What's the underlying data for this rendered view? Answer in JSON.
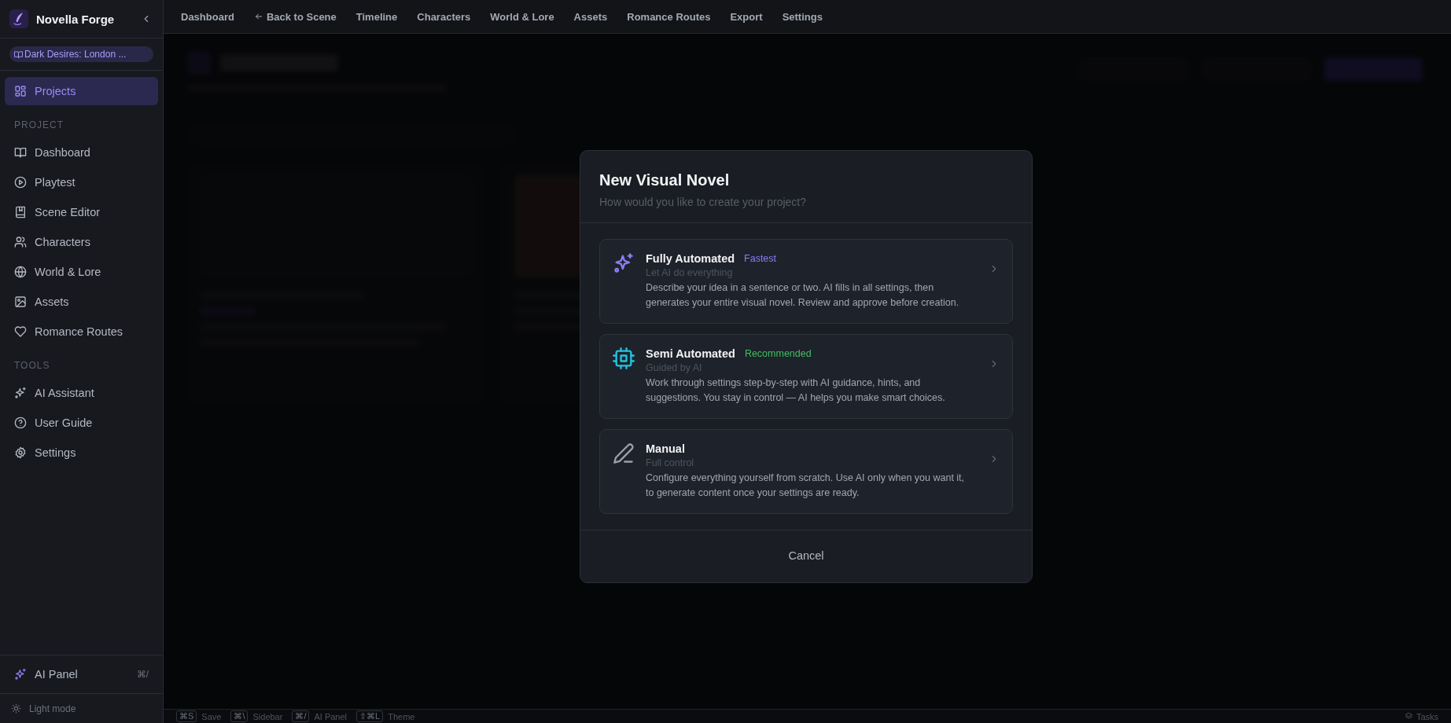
{
  "sidebar": {
    "app_name": "Novella Forge",
    "project_chip": "Dark Desires: London ...",
    "top_items": [
      {
        "label": "Projects",
        "kind": "grid",
        "selected": true
      }
    ],
    "sections": [
      {
        "heading": "PROJECT",
        "items": [
          {
            "label": "Dashboard",
            "kind": "book",
            "selected": false
          },
          {
            "label": "Playtest",
            "kind": "play",
            "selected": false
          },
          {
            "label": "Scene Editor",
            "kind": "bookmark",
            "selected": false
          },
          {
            "label": "Characters",
            "kind": "users",
            "selected": false
          },
          {
            "label": "World & Lore",
            "kind": "globe",
            "selected": false
          },
          {
            "label": "Assets",
            "kind": "image",
            "selected": false
          },
          {
            "label": "Romance Routes",
            "kind": "heart",
            "selected": false
          }
        ]
      },
      {
        "heading": "TOOLS",
        "items": [
          {
            "label": "AI Assistant",
            "kind": "sparkles",
            "selected": false
          },
          {
            "label": "User Guide",
            "kind": "help",
            "selected": false
          },
          {
            "label": "Settings",
            "kind": "gear",
            "selected": false
          }
        ]
      }
    ],
    "ai_panel": {
      "label": "AI Panel",
      "shortcut": "⌘/"
    },
    "theme_toggle": "Light mode"
  },
  "top_nav": [
    {
      "label": "Dashboard",
      "kind": "link"
    },
    {
      "label": "Back to Scene",
      "kind": "back"
    },
    {
      "label": "Timeline",
      "kind": "link"
    },
    {
      "label": "Characters",
      "kind": "link"
    },
    {
      "label": "World & Lore",
      "kind": "link"
    },
    {
      "label": "Assets",
      "kind": "link"
    },
    {
      "label": "Romance Routes",
      "kind": "link"
    },
    {
      "label": "Export",
      "kind": "link"
    },
    {
      "label": "Settings",
      "kind": "link"
    }
  ],
  "modal": {
    "title": "New Visual Novel",
    "subtitle": "How would you like to create your project?",
    "options": [
      {
        "kind": "sparkles",
        "title": "Fully Automated",
        "badge": "Fastest",
        "color": "#8b7cf6",
        "subtitle": "Let AI do everything",
        "description": "Describe your idea in a sentence or two. AI fills in all settings, then generates your entire visual novel. Review and approve before creation."
      },
      {
        "kind": "chip",
        "title": "Semi Automated",
        "badge": "Recommended",
        "color": "#3fbf5f",
        "subtitle": "Guided by AI",
        "description": "Work through settings step-by-step with AI guidance, hints, and suggestions. You stay in control — AI helps you make smart choices."
      },
      {
        "kind": "pen",
        "title": "Manual",
        "subtitle": "Full control",
        "description": "Configure everything yourself from scratch. Use AI only when you want it, to generate content once your settings are ready."
      }
    ],
    "cancel": "Cancel"
  },
  "status_bar": {
    "shortcuts": [
      {
        "key": "⌘S",
        "label": "Save"
      },
      {
        "key": "⌘\\",
        "label": "Sidebar"
      },
      {
        "key": "⌘/",
        "label": "AI Panel"
      },
      {
        "key": "⇧⌘L",
        "label": "Theme"
      }
    ],
    "tasks": "Tasks"
  }
}
